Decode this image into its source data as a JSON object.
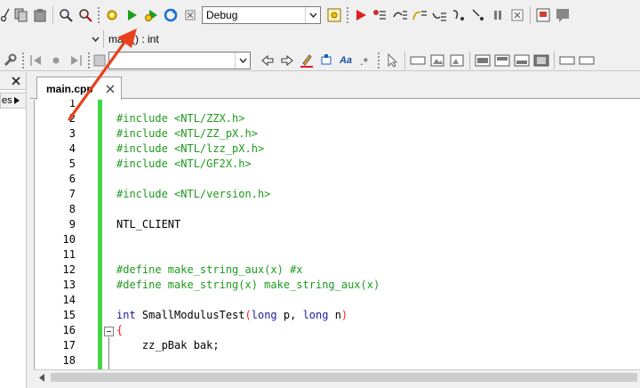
{
  "toolbar": {
    "build_config": "Debug",
    "icons": [
      "cut-icon",
      "copy-icon",
      "paste-icon",
      "find-icon",
      "replace-icon",
      "compile-icon",
      "run-icon",
      "build-run-icon",
      "rebuild-icon",
      "stop-icon",
      "project-options-icon",
      "debug-icon",
      "step-into-icon",
      "step-over-icon",
      "step-out-icon",
      "run-to-cursor-icon",
      "skip-icon",
      "pause-icon",
      "abort-icon",
      "watch-icon",
      "chat-icon"
    ]
  },
  "scope": {
    "function": "main() : int"
  },
  "search": {
    "value": ""
  },
  "left_panel": {
    "tab_label": "es"
  },
  "editor": {
    "tab_title": "main.cpp",
    "lines": [
      {
        "num": "1",
        "segments": []
      },
      {
        "num": "2",
        "segments": [
          {
            "t": "#include <NTL/ZZX.h>",
            "c": "kwg"
          }
        ]
      },
      {
        "num": "3",
        "segments": [
          {
            "t": "#include <NTL/ZZ_pX.h>",
            "c": "kwg"
          }
        ]
      },
      {
        "num": "4",
        "segments": [
          {
            "t": "#include <NTL/lzz_pX.h>",
            "c": "kwg"
          }
        ]
      },
      {
        "num": "5",
        "segments": [
          {
            "t": "#include <NTL/GF2X.h>",
            "c": "kwg"
          }
        ]
      },
      {
        "num": "6",
        "segments": []
      },
      {
        "num": "7",
        "segments": [
          {
            "t": "#include <NTL/version.h>",
            "c": "kwg"
          }
        ]
      },
      {
        "num": "8",
        "segments": []
      },
      {
        "num": "9",
        "segments": [
          {
            "t": "NTL_CLIENT",
            "c": ""
          }
        ]
      },
      {
        "num": "10",
        "segments": []
      },
      {
        "num": "11",
        "segments": []
      },
      {
        "num": "12",
        "segments": [
          {
            "t": "#define make_string_aux(x) #x",
            "c": "kwg"
          }
        ]
      },
      {
        "num": "13",
        "segments": [
          {
            "t": "#define make_string(x) make_string_aux(x)",
            "c": "kwg"
          }
        ]
      },
      {
        "num": "14",
        "segments": []
      },
      {
        "num": "15",
        "segments": [
          {
            "t": "int",
            "c": "kwb"
          },
          {
            "t": " SmallModulusTest",
            "c": ""
          },
          {
            "t": "(",
            "c": "par"
          },
          {
            "t": "long",
            "c": "kwb"
          },
          {
            "t": " p, ",
            "c": ""
          },
          {
            "t": "long",
            "c": "kwb"
          },
          {
            "t": " n",
            "c": ""
          },
          {
            "t": ")",
            "c": "par"
          }
        ]
      },
      {
        "num": "16",
        "segments": [
          {
            "t": "{",
            "c": "par"
          }
        ]
      },
      {
        "num": "17",
        "segments": [
          {
            "t": "    zz_pBak bak;",
            "c": ""
          }
        ]
      },
      {
        "num": "18",
        "segments": []
      }
    ]
  },
  "colors": {
    "change_bar": "#44d444",
    "annotation_arrow": "#e8401c"
  }
}
